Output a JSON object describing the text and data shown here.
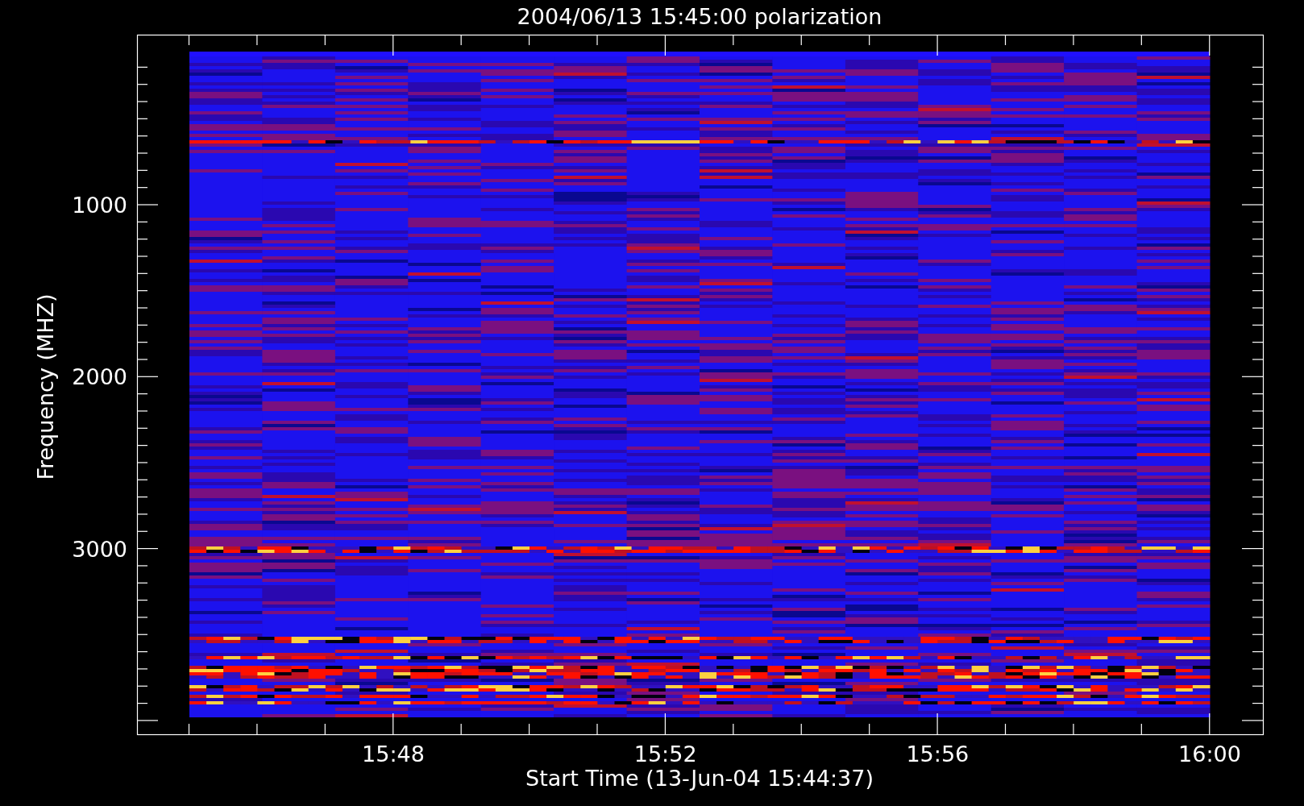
{
  "title": "2004/06/13 15:45:00 polarization",
  "y_axis": {
    "label": "Frequency (MHZ)",
    "ticks": [
      "1000",
      "2000",
      "3000"
    ]
  },
  "x_axis": {
    "label": "Start Time (13-Jun-04 15:44:37)",
    "ticks": [
      "15:48",
      "15:52",
      "15:56",
      "16:00"
    ]
  }
}
